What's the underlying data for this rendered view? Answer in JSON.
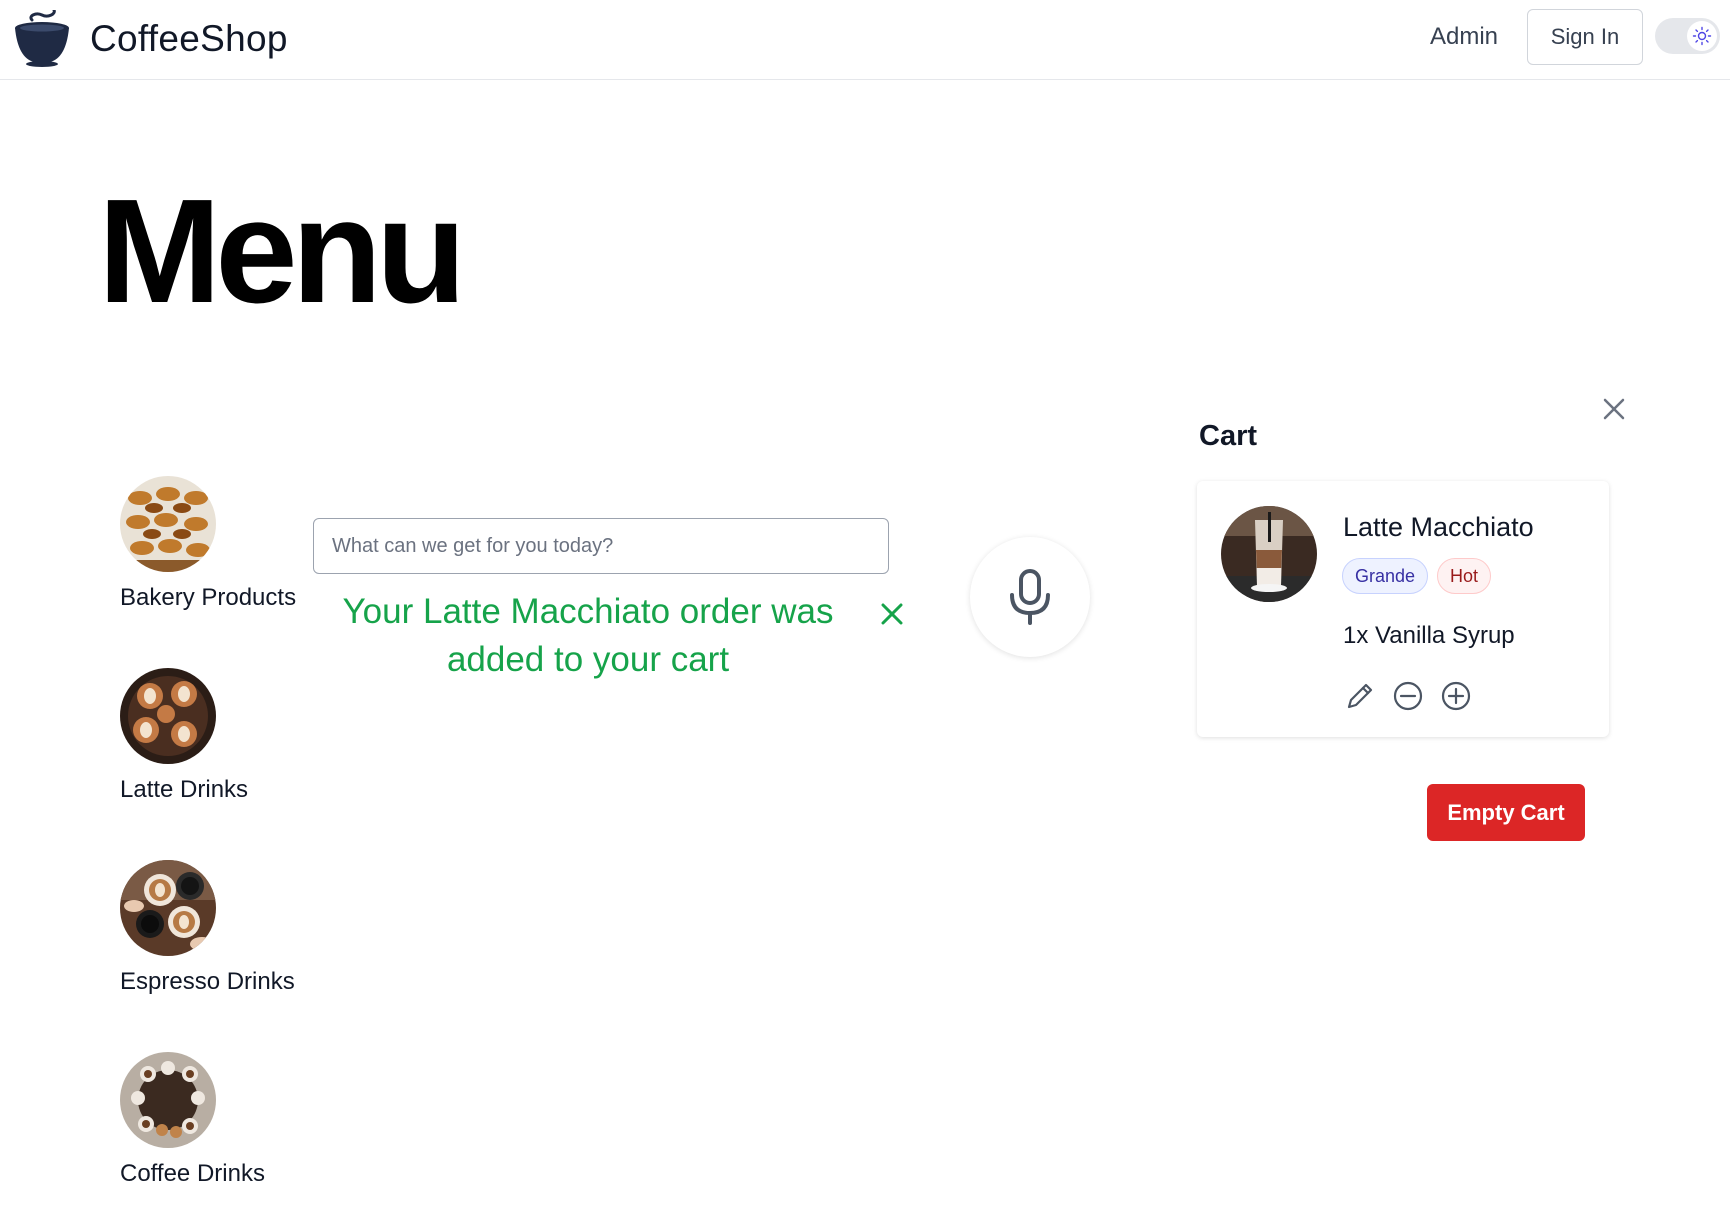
{
  "header": {
    "brand": "CoffeeShop",
    "admin_link": "Admin",
    "signin_label": "Sign In",
    "theme_toggle_icon": "sun-icon"
  },
  "page_title": "Menu",
  "categories": [
    {
      "label": "Bakery Products",
      "icon": "pastries-photo"
    },
    {
      "label": "Latte Drinks",
      "icon": "latte-art-photo"
    },
    {
      "label": "Espresso Drinks",
      "icon": "espresso-cups-photo"
    },
    {
      "label": "Coffee Drinks",
      "icon": "coffee-table-photo"
    }
  ],
  "search": {
    "placeholder": "What can we get for you today?",
    "value": ""
  },
  "toast": {
    "message": "Your Latte Macchiato order was added to your cart",
    "color": "#16a34a"
  },
  "cart": {
    "title": "Cart",
    "items": [
      {
        "name": "Latte Macchiato",
        "size": "Grande",
        "temperature": "Hot",
        "addon": "1x Vanilla Syrup"
      }
    ],
    "empty_label": "Empty Cart",
    "empty_color": "#dc2626"
  },
  "colors": {
    "success": "#16a34a",
    "danger": "#dc2626",
    "badge_size_text": "#3730a3",
    "badge_temp_text": "#991b1b"
  }
}
